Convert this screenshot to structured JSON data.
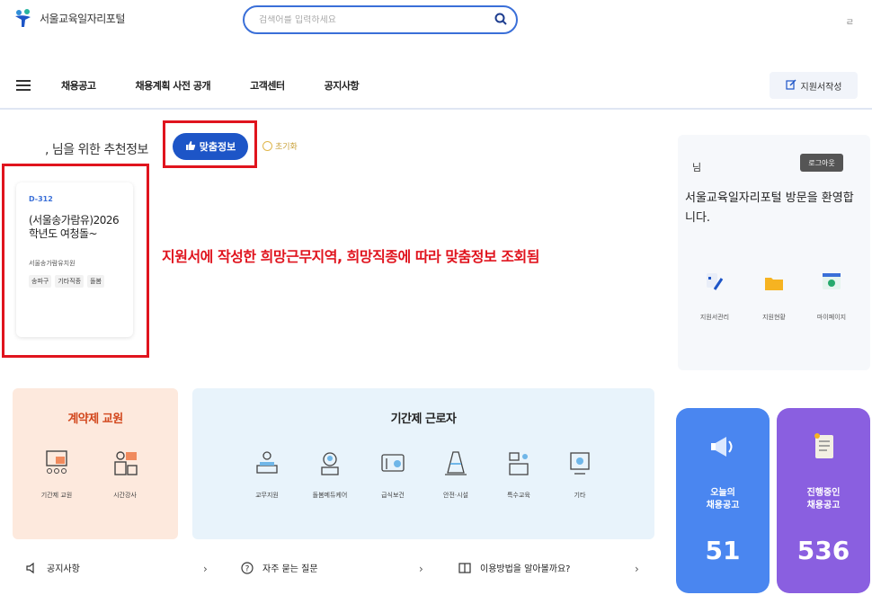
{
  "header": {
    "logo_text": "서울교육일자리포털",
    "search_placeholder": "검색어를 입력하세요",
    "right_text": "ㄹ"
  },
  "nav": {
    "items": [
      "채용공고",
      "채용계획 사전 공개",
      "고객센터",
      "공지사항"
    ],
    "apply_button": "지원서작성"
  },
  "recommend": {
    "title": ", 님을 위한 추천정보",
    "tab_label": "맞춤정보",
    "reset_label": "초기화"
  },
  "job_card": {
    "dday": "D-312",
    "title": "(서울송가람유)2026학년도 여청돌~",
    "org": "서울송가람유치원",
    "tags": [
      "송파구",
      "기타직종",
      "돌봄"
    ]
  },
  "annotation": "지원서에 작성한 희망근무지역, 희망직종에 따라 맞춤정보 조회됨",
  "user_panel": {
    "name": "님",
    "logout": "로그아웃",
    "welcome": "서울교육일자리포털 방문을 환영합니다.",
    "links": [
      {
        "label": "지원서관리",
        "icon": "edit-icon"
      },
      {
        "label": "지원현황",
        "icon": "folder-icon"
      },
      {
        "label": "마이페이지",
        "icon": "profile-icon"
      }
    ]
  },
  "contract": {
    "title": "계약제 교원",
    "items": [
      {
        "label": "기간제 교원",
        "icon": "classroom-icon"
      },
      {
        "label": "시간강사",
        "icon": "lecturer-icon"
      }
    ]
  },
  "temp": {
    "title": "기간제 근로자",
    "items": [
      {
        "label": "교무지원",
        "icon": "desk-lamp-icon"
      },
      {
        "label": "돌봄메듀케어",
        "icon": "care-icon"
      },
      {
        "label": "급식보건",
        "icon": "meal-icon"
      },
      {
        "label": "안전·시설",
        "icon": "cone-icon"
      },
      {
        "label": "특수교육",
        "icon": "special-edu-icon"
      },
      {
        "label": "기타",
        "icon": "monitor-icon"
      }
    ]
  },
  "stats": [
    {
      "label": "오늘의\n채용공고",
      "value": "51",
      "color": "#4a86f0",
      "icon": "megaphone-icon"
    },
    {
      "label": "진행중인\n채용공고",
      "value": "536",
      "color": "#8a5fe0",
      "icon": "notice-board-icon"
    }
  ],
  "bottom_links": [
    {
      "label": "공지사항",
      "icon": "speaker-icon"
    },
    {
      "label": "자주 묻는 질문",
      "icon": "question-icon"
    },
    {
      "label": "이용방법을 알아볼까요?",
      "icon": "book-icon"
    }
  ],
  "colors": {
    "primary": "#1d55c7",
    "highlight_red": "#e0141e",
    "contract_bg": "#fde9dd",
    "temp_bg": "#e8f3fb"
  }
}
